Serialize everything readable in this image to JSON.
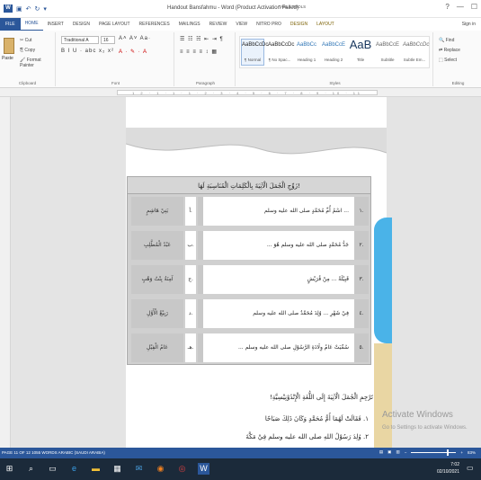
{
  "titlebar": {
    "title": "Handout Bansfahmu - Word (Product Activation Failed)",
    "table_tools": "TABLE TOOLS",
    "help": "?",
    "minimize": "—",
    "restore": "☐"
  },
  "tabs": [
    "FILE",
    "HOME",
    "INSERT",
    "DESIGN",
    "PAGE LAYOUT",
    "REFERENCES",
    "MAILINGS",
    "REVIEW",
    "VIEW",
    "NITRO PRO",
    "DESIGN",
    "LAYOUT"
  ],
  "signin": "Sign in",
  "clipboard": {
    "paste": "Paste",
    "cut": "Cut",
    "copy": "Copy",
    "format_painter": "Format Painter",
    "label": "Clipboard"
  },
  "font": {
    "name": "Traditional A",
    "size": "16",
    "format_row": "B I U · abc x₂ x²",
    "label": "Font"
  },
  "paragraph": {
    "label": "Paragraph"
  },
  "styles": {
    "items": [
      {
        "preview": "AaBbCcDc",
        "name": "¶ Normal"
      },
      {
        "preview": "AaBbCcDc",
        "name": "¶ No Spac..."
      },
      {
        "preview": "AaBbCc",
        "name": "Heading 1"
      },
      {
        "preview": "AaBbCcE",
        "name": "Heading 2"
      },
      {
        "preview": "AaB",
        "name": "Title"
      },
      {
        "preview": "AaBbCcE",
        "name": "Subtitle"
      },
      {
        "preview": "AaBbCcDc",
        "name": "Subtle Em..."
      }
    ],
    "label": "Styles"
  },
  "editing": {
    "find": "Find",
    "replace": "Replace",
    "select": "Select",
    "label": "Editing"
  },
  "ruler": {
    "ticks": "1 2 · 1 · 1 · 1 · 2 · 3 · 4 · 5 · 6 · 7 · 8 · 9 · 10 · 11"
  },
  "exercise": {
    "heading": "زَوِّجِ الْجُمَلَ الْآتِيَةَ بِالْكَلِمَاتِ الْمُنَاسِبَةِ لَهَا!",
    "rows": [
      {
        "num": "١.",
        "question": "... اسْمُ أُمِّ مُحَمَّدٍ صلى الله عليه وسلم",
        "letter": "أ.",
        "answer": "بَنِيْ هَاشِمٍ"
      },
      {
        "num": "٢.",
        "question": "جَدُّ مُحَمَّدٍ صلى الله عليه وسلم هُوَ ...",
        "letter": "ب.",
        "answer": "عَبْدُ الْمُطَّلِبِ"
      },
      {
        "num": "٣.",
        "question": "قَبِيْلَةُ ... مِنْ قُرَيْشٍ",
        "letter": "ج.",
        "answer": "آمِنَةُ بِنْتُ وَهْبٍ"
      },
      {
        "num": "٤.",
        "question": "فِيْ شَهْرِ ... وُلِدَ مُحَمَّدٌ صلى الله عليه وسلم",
        "letter": "د.",
        "answer": "رَبِيْعُ الْأَوَّلِ"
      },
      {
        "num": "٥.",
        "question": "سُمِّيَتْ عَامُ وِلَادَةِ الرَّسُوْلِ صلى الله عليه وسلم ...",
        "letter": "هـ.",
        "answer": "عَامُ الْفِيْلِ"
      }
    ]
  },
  "section2": {
    "title": "تَرْجِمِ الْجُمَلَ الْآتِيَةَ إِلَى اللُّغَةِ الْإِنْدُوْنِيْسِيَّةِ!",
    "line1": "١. فَقَالَتْ لَهُمَا أُمُّ مُحَمَّدٍ وَكَانَ ذَلِكَ صَبَاحًا",
    "line2": "٢. وُلِدَ رَسُوْلُ اللهِ صلى الله عليه وسلم فِيْ مَكَّةَ"
  },
  "activation": {
    "title": "Activate Windows",
    "sub": "Go to Settings to activate Windows."
  },
  "statusbar": {
    "left": "PAGE 11 OF 12    1055 WORDS    ARABIC (SAUDI ARABIA)",
    "zoom": "83%",
    "zoom_level": 0.83
  },
  "taskbar": {
    "time": "7:02",
    "date": "02/10/2021"
  },
  "colors": {
    "accent": "#2b579a",
    "table_gray": "#d0d0d0",
    "side_blue": "#4ab3e8",
    "side_beige": "#e9d6a3"
  }
}
